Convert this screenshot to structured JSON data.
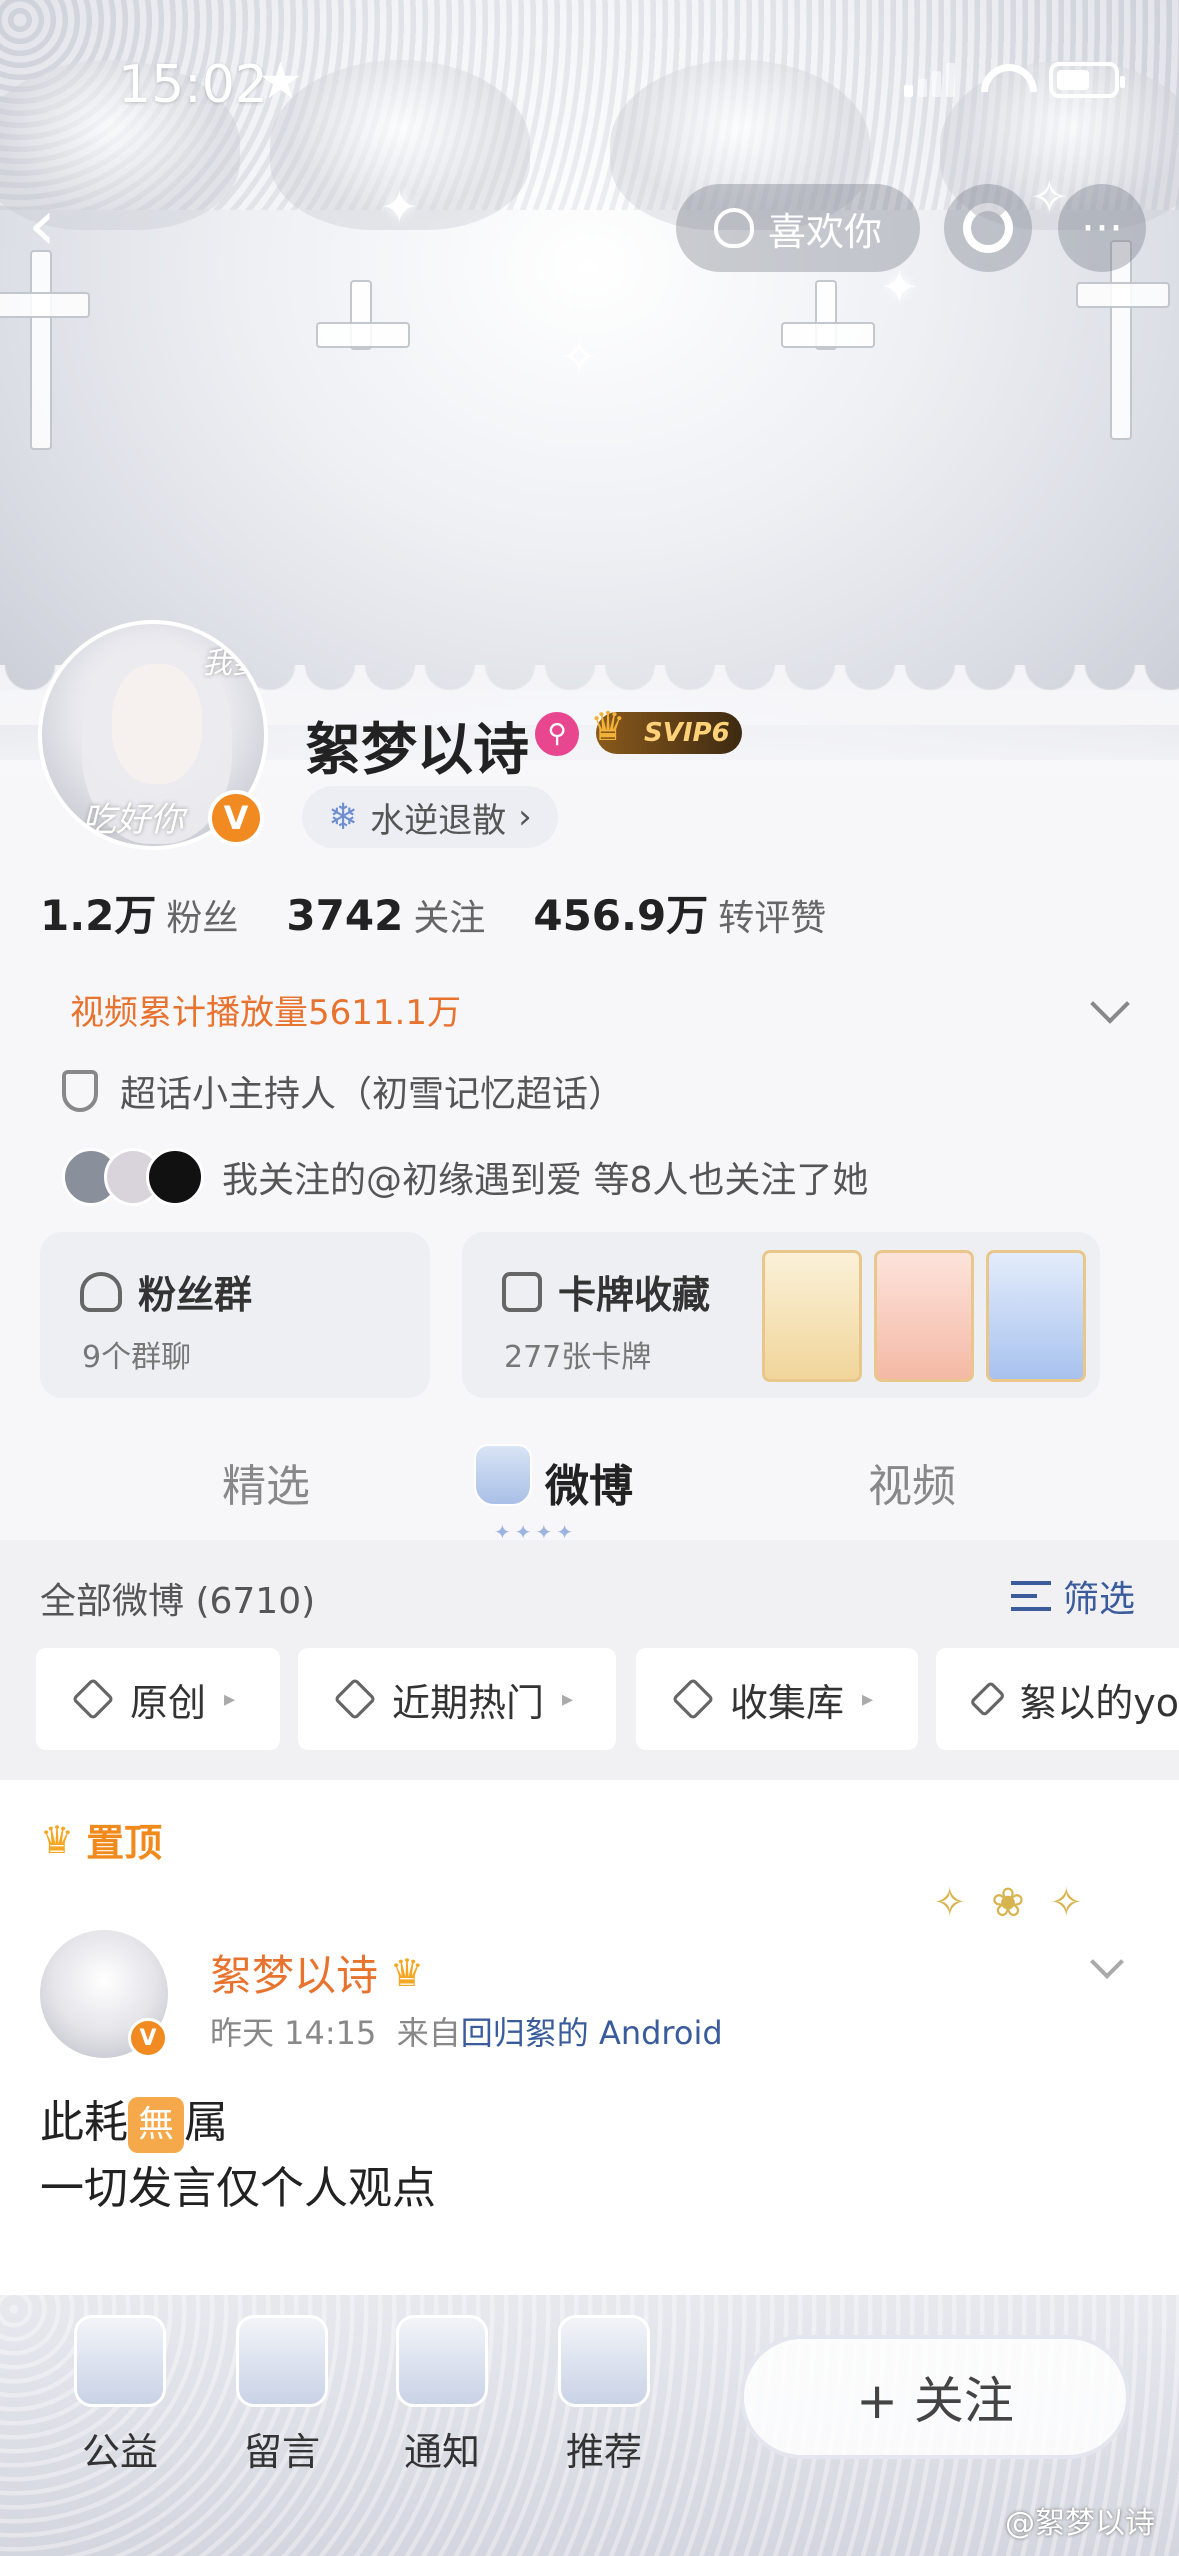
{
  "status_bar": {
    "time": "15:02",
    "star": "★"
  },
  "nav": {
    "back_icon": "‹",
    "like_label": "喜欢你",
    "more_icon": "···"
  },
  "profile": {
    "name": "絮梦以诗",
    "svip_label": "SVIP6",
    "tag_label": "水逆退散",
    "tag_arrow": "›",
    "avatar_text_top": "我要",
    "avatar_text_bottom": "吃好你",
    "verified_badge": "V",
    "stats": [
      {
        "value": "1.2万",
        "label": "粉丝"
      },
      {
        "value": "3742",
        "label": "关注"
      },
      {
        "value": "456.9万",
        "label": "转评赞"
      }
    ],
    "video_plays": "视频累计播放量5611.1万",
    "host_role": "超话小主持人（初雪记忆超话）",
    "mutual_follow": "我关注的@初缘遇到爱 等8人也关注了她"
  },
  "cards": {
    "fan_group": {
      "title": "粉丝群",
      "sub": "9个群聊"
    },
    "card_collection": {
      "title": "卡牌收藏",
      "sub": "277张卡牌"
    }
  },
  "tabs": [
    {
      "label": "精选"
    },
    {
      "label": "微博"
    },
    {
      "label": "视频"
    }
  ],
  "filter": {
    "all_weibo": "全部微博 (6710)",
    "filter_label": "筛选",
    "chips": [
      {
        "label": "原创"
      },
      {
        "label": "近期热门"
      },
      {
        "label": "收集库"
      },
      {
        "label": "絮以的yo"
      }
    ]
  },
  "post": {
    "pinned_label": "置顶",
    "author": "絮梦以诗",
    "time": "昨天 14:15",
    "source_prefix": "来自",
    "source": "回归絮的 Android",
    "body_line1_a": "此耗",
    "body_badge": "無",
    "body_line1_b": "属",
    "body_line2": "一切发言仅个人观点",
    "deco": "✧ ❀ ✧"
  },
  "bottom_bar": {
    "items": [
      {
        "label": "公益"
      },
      {
        "label": "留言"
      },
      {
        "label": "通知"
      },
      {
        "label": "推荐"
      }
    ],
    "follow_label": "+ 关注",
    "watermark": "@絮梦以诗"
  },
  "colors": {
    "accent_orange": "#e8732e",
    "link_blue": "#3b5c9c",
    "verified": "#f28a22"
  },
  "battery_level": 0.6
}
